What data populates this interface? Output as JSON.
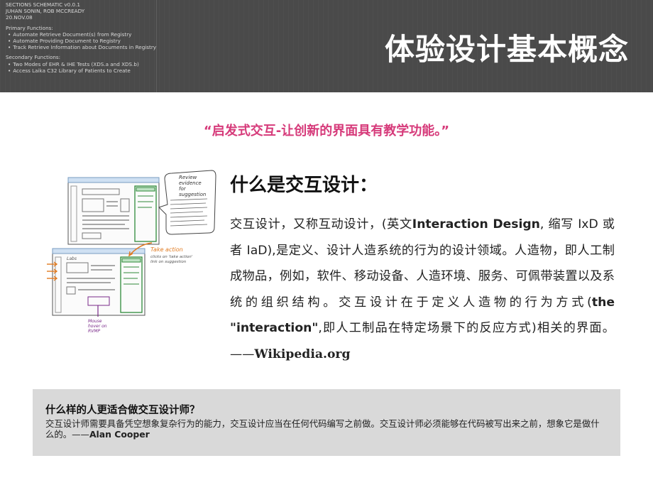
{
  "header": {
    "schematic_lines_1": [
      "SECTIONS SCHEMATIC v0.0.1",
      "JUHAN SONIN, ROB MCCREADY",
      "20.NOV.08"
    ],
    "primary_title": "Primary Functions:",
    "primary_items": [
      "Automate Retrieve Document(s) from Registry",
      "Automate Providing Document to Registry",
      "Track Retrieve Information about Documents in Registry"
    ],
    "secondary_title": "Secondary Functions:",
    "secondary_items": [
      "Two Modes of EHR & IHE Tests (XDS.a and XDS.b)",
      "Access Laika C32 Library of Patients to Create"
    ],
    "slide_title": "体验设计基本概念"
  },
  "quote": "“启发式交互-让创新的界面具有教学功能。”",
  "sketch": {
    "annotation_review": [
      "Review",
      "evidence",
      "for",
      "suggestion"
    ],
    "annotation_take_action": "Take action",
    "annotation_take_action_note": [
      "clicks on 'take action'",
      "link on suggestion"
    ],
    "annotation_mouse": [
      "Mouse",
      "hover on",
      "RVMP"
    ],
    "annotation_labs": "Labs"
  },
  "section": {
    "title": "什么是交互设计：",
    "body": {
      "p1": "交互设计，又称互动设计，(英文",
      "term_en": "Interaction Design",
      "p2": ", 缩写 IxD 或者 IaD),是定义、设计人造系统的行为的设计领域。人造物，即人工制成物品，例如，软件、移动设备、人造环境、服务、可佩带装置以及系统的组织结构。交互设计在于定义人造物的行为方式(",
      "the": "the",
      "interaction": "\"interaction\"",
      "p3": ",即人工制品在特定场景下的反应方式)相关的界面。——",
      "source": "Wikipedia.org"
    }
  },
  "callout": {
    "title": "什么样的人更适合做交互设计师？",
    "body": "交互设计师需要具备凭空想象复杂行为的能力，交互设计应当在任何代码编写之前做。交互设计师必须能够在代码被写出来之前，想象它是做什么的。——",
    "author": "Alan   Cooper"
  }
}
